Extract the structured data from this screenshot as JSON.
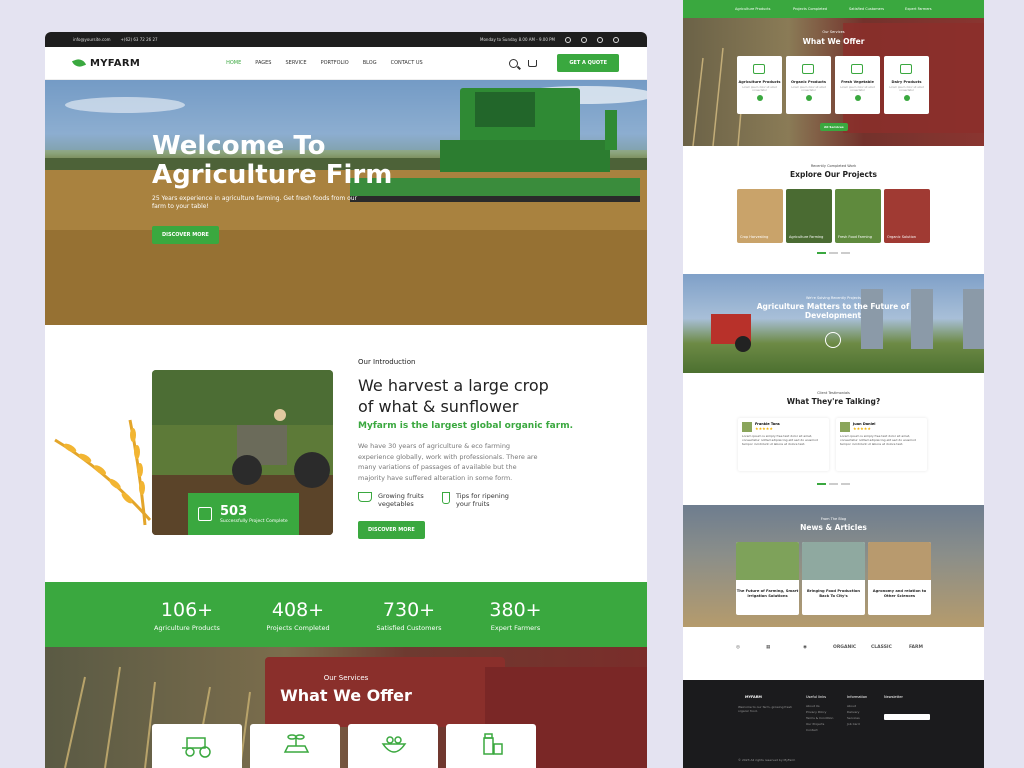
{
  "colors": {
    "primary": "#3aa83f",
    "dark": "#1e1e1e",
    "background": "#e4e3f1"
  },
  "topbar": {
    "email": "info@yoursite.com",
    "phone": "+(62) 63 72 26 27",
    "hours": "Monday to Sunday 8.00 AM - 9.00 PM",
    "social_icons": [
      "instagram-icon",
      "youtube-icon",
      "facebook-icon",
      "linkedin-icon"
    ]
  },
  "nav": {
    "brand": "MYFARM",
    "items": [
      {
        "label": "HOME"
      },
      {
        "label": "PAGES"
      },
      {
        "label": "SERVICE"
      },
      {
        "label": "PORTFOLIO"
      },
      {
        "label": "BLOG"
      },
      {
        "label": "CONTACT US"
      }
    ],
    "cta": "GET A QUOTE"
  },
  "hero": {
    "title_line1": "Welcome To",
    "title_line2": "Agriculture Firm",
    "subtitle": "25 Years experience in agriculture farming. Get fresh foods from our farm to your table!",
    "button": "DISCOVER MORE"
  },
  "intro": {
    "kicker": "Our Introduction",
    "heading_line1": "We harvest a large crop",
    "heading_line2": "of what & sunflower",
    "green_text": "Myfarm is the largest global organic farm.",
    "body": "We have 30 years of agriculture & eco farming experience globally, work with professionals. There are many variations of passages of available but the majority have suffered alteration in some form.",
    "badge_value": "503",
    "badge_label": "Successfully Project Complete",
    "features": [
      {
        "label": "Growing fruits vegetables",
        "icon": "basket-icon"
      },
      {
        "label": "Tips for ripening your fruits",
        "icon": "flask-icon"
      }
    ],
    "button": "DISCOVER MORE"
  },
  "stats": [
    {
      "value": "106+",
      "label": "Agriculture Products"
    },
    {
      "value": "408+",
      "label": "Projects Completed"
    },
    {
      "value": "730+",
      "label": "Satisfied Customers"
    },
    {
      "value": "380+",
      "label": "Expert Farmers"
    }
  ],
  "services": {
    "kicker": "Our Services",
    "title": "What We Offer",
    "icons": [
      "tractor-icon",
      "seedling-icon",
      "vegetables-icon",
      "dairy-icon"
    ]
  },
  "right": {
    "stats_labels": [
      "Agriculture Products",
      "Projects Completed",
      "Satisfied Customers",
      "Expert Farmers"
    ],
    "offer_kicker": "Our Services",
    "offer_title": "What We Offer",
    "offer_cards": [
      {
        "title": "Agriculture Products",
        "desc": "Lorem ipsum dolor sit amet consectetur"
      },
      {
        "title": "Organic Products",
        "desc": "Lorem ipsum dolor sit amet consectetur"
      },
      {
        "title": "Fresh Vegetable",
        "desc": "Lorem ipsum dolor sit amet consectetur"
      },
      {
        "title": "Dairy Products",
        "desc": "Lorem ipsum dolor sit amet consectetur"
      }
    ],
    "offer_button": "All Services",
    "projects_kicker": "Recently Completed Work",
    "projects_title": "Explore Our Projects",
    "projects": [
      {
        "label": "Crop Harvesting"
      },
      {
        "label": "Agriculture Farming"
      },
      {
        "label": "Fresh Food Farming"
      },
      {
        "label": "Organic Solution"
      }
    ],
    "band_kicker": "We're Solving Recently Projects",
    "band_title": "Agriculture Matters to the Future of Development",
    "testimonials_kicker": "Client Testimonials",
    "testimonials_title": "What They're Talking?",
    "testimonials": [
      {
        "name": "Frankie Tons",
        "role": "Client",
        "stars": "★★★★★",
        "quote": "Lorem ipsum is simply free text dolor sit amet, consectetur notted adipisicing elit sed do eiusmod tempor incididunt ut labore et dolore text."
      },
      {
        "name": "Juan Daniel",
        "role": "Client",
        "stars": "★★★★★",
        "quote": "Lorem ipsum is simply free text dolor sit amet, consectetur notted adipisicing elit sed do eiusmod tempor incididunt ut labore et dolore text."
      }
    ],
    "news_kicker": "From The Blog",
    "news_title": "News & Articles",
    "news": [
      {
        "title": "The Future of Farming, Smart Irrigation Solutions"
      },
      {
        "title": "Bringing Food Production Back To City's"
      },
      {
        "title": "Agronomy and relation to Other Sciences"
      }
    ],
    "brands": [
      "ORGANIC",
      "CLASSIC",
      "FARM"
    ],
    "footer": {
      "brand": "MYFARM",
      "about": "Welcome to our farm, growing fresh organic food.",
      "col1_title": "Useful links",
      "col1": [
        "About Us",
        "Privacy Policy",
        "Terms & Condition",
        "Our Projects",
        "Contact"
      ],
      "col2_title": "Information",
      "col2": [
        "About",
        "Delivery",
        "Services",
        "Job Card"
      ],
      "col3_title": "Newsletter",
      "copyright": "© 2023 All rights reserved by MyFarm"
    }
  }
}
